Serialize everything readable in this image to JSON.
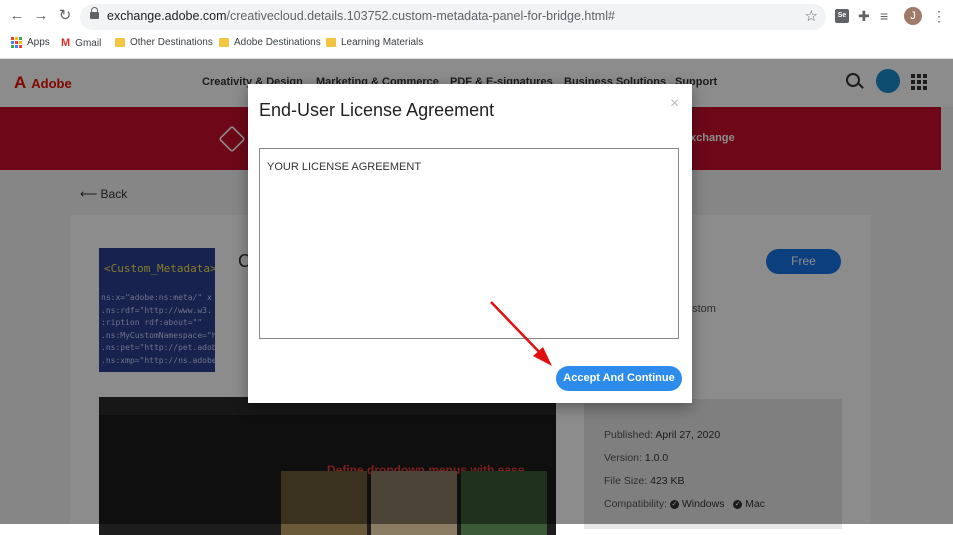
{
  "browser": {
    "url_host": "exchange.adobe.com",
    "url_path": "/creativecloud.details.103752.custom-metadata-panel-for-bridge.html#",
    "profile_initial": "J",
    "ext_label": "Se",
    "bookmarks": [
      {
        "label": "Apps",
        "icon": "apps-grid-icon"
      },
      {
        "label": "Gmail",
        "icon": "gmail-icon"
      },
      {
        "label": "Other Destinations",
        "icon": "folder-icon"
      },
      {
        "label": "Adobe Destinations",
        "icon": "folder-icon"
      },
      {
        "label": "Learning Materials",
        "icon": "folder-icon"
      }
    ]
  },
  "site": {
    "brand": "Adobe",
    "nav": [
      "Creativity & Design",
      "Marketing & Commerce",
      "PDF & E-signatures",
      "Business Solutions",
      "Support"
    ],
    "hero_text": "xchange",
    "back": "Back",
    "thumb_title": "<Custom_Metadata>",
    "thumb_code": "ns:x=\"adobe:ns:meta/\" x\n.ns:rdf=\"http://www.w3.\n:ription rdf:about=\"\"\n.ns:MyCustomNamespace=\"h\n.ns:pet=\"http://pet.adob\n.ns:xmp=\"http://ns.adobe",
    "ext_title_partial": "C",
    "free_label": "Free",
    "desc_tail": "ustom",
    "ss_caption": "Define dropdown menus with ease",
    "info": {
      "published_label": "Published:",
      "published_value": "April 27, 2020",
      "version_label": "Version:",
      "version_value": "1.0.0",
      "size_label": "File Size:",
      "size_value": "423 KB",
      "compat_label": "Compatibility:",
      "compat_windows": "Windows",
      "compat_mac": "Mac"
    }
  },
  "modal": {
    "title": "End-User License Agreement",
    "close": "×",
    "license_text": "YOUR LICENSE AGREEMENT",
    "accept_label": "Accept And Continue"
  },
  "colors": {
    "adobe_red": "#c8102e",
    "button_blue": "#2d8ceb",
    "arrow_red": "#e01010"
  }
}
